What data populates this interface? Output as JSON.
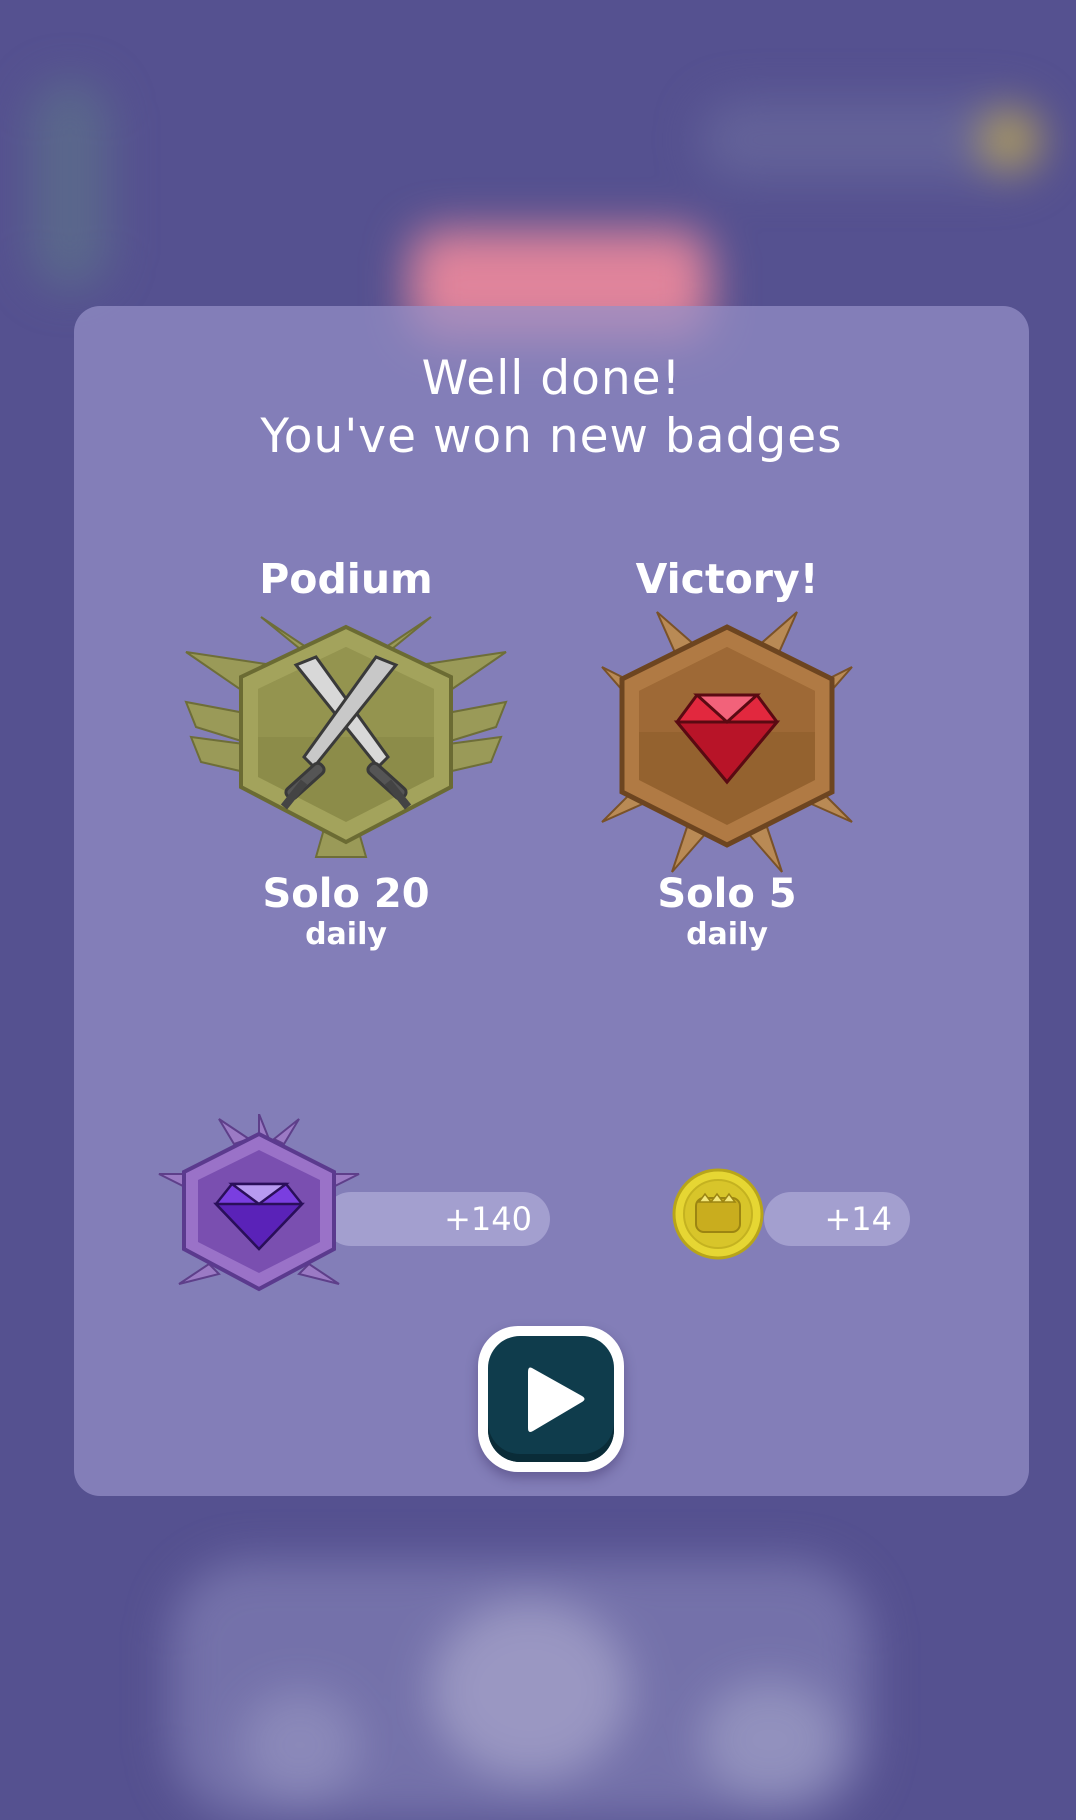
{
  "modal": {
    "title_line1": "Well done!",
    "title_line2": "You've won new badges"
  },
  "badges": [
    {
      "name": "Podium",
      "subtitle": "Solo 20",
      "period": "daily",
      "icon": "crossed-swords-icon",
      "frame_color": "#8a8a4a"
    },
    {
      "name": "Victory!",
      "subtitle": "Solo 5",
      "period": "daily",
      "icon": "red-gem-icon",
      "frame_color": "#9a6a3a"
    }
  ],
  "rewards": {
    "gems": {
      "value": "+140",
      "icon": "purple-gem-badge-icon"
    },
    "coins": {
      "value": "+14",
      "icon": "gold-coin-icon"
    }
  },
  "buttons": {
    "play": {
      "icon": "play-icon"
    }
  },
  "colors": {
    "background": "#555190",
    "modal": "#9690c8",
    "play_button": "#0f3c4c",
    "coin": "#e8d93a"
  }
}
